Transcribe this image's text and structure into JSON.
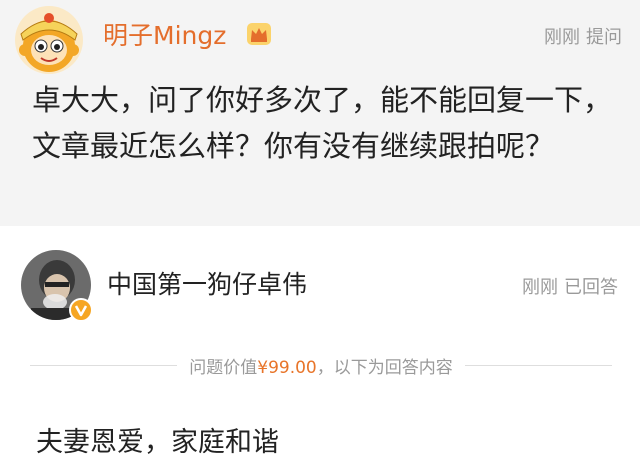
{
  "question": {
    "asker_name": "明子Mingz",
    "time": "刚刚",
    "action": "提问",
    "text": "卓大大，问了你好多次了，能不能回复一下，文章最近怎么样？你有没有继续跟拍呢？"
  },
  "answer": {
    "answerer_name": "中国第一狗仔卓伟",
    "time": "刚刚",
    "status": "已回答",
    "divider": {
      "prefix": "问题价值",
      "price": "¥99.00",
      "suffix": "，以下为回答内容"
    },
    "text": "夫妻恩爱，家庭和谐"
  },
  "colors": {
    "asker_name": "#e46e2c",
    "price": "#e8752a",
    "meta_gray": "#9a9a9a",
    "card_bg": "#f4f4f4"
  },
  "icons": {
    "asker_avatar": "cartoon-monkey-king-avatar",
    "vip_badge": "crown-icon",
    "verified_badge": "verified-v-icon"
  }
}
